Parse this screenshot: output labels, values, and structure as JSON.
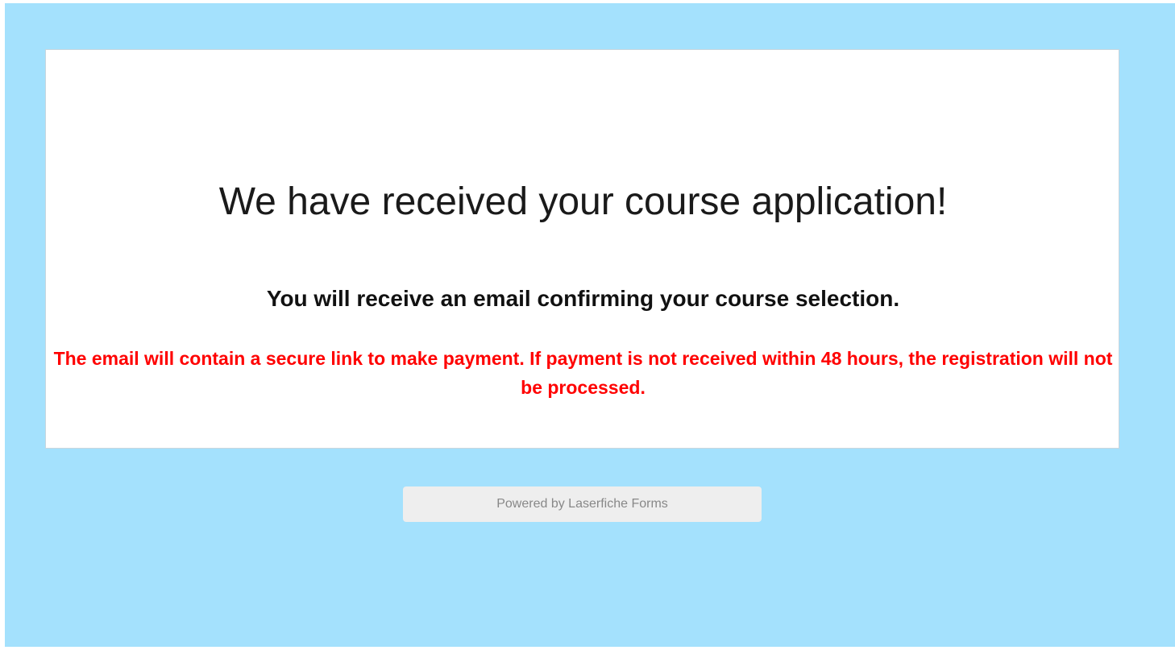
{
  "confirmation": {
    "headline": "We have received your course application!",
    "subline": "You will receive an email confirming your course selection.",
    "warning": "The email will contain a secure link to make payment. If payment is not received within 48 hours, the registration will not be processed."
  },
  "footer": {
    "powered_by": "Powered by Laserfiche Forms"
  },
  "colors": {
    "page_background": "#a4e1fd",
    "card_background": "#ffffff",
    "warning_text": "#ff0000",
    "footer_button": "#eeeeee"
  }
}
